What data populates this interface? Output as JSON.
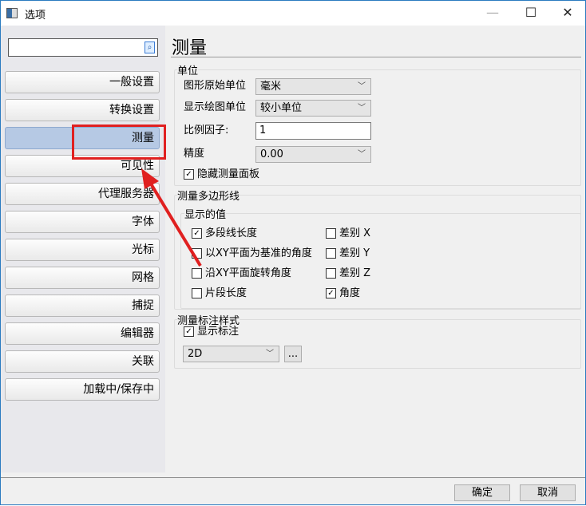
{
  "window": {
    "title": "选项",
    "minimize": "—",
    "maximize": "☐",
    "close": "✕"
  },
  "sidebar": {
    "search_value": "",
    "items": [
      {
        "label": "一般设置"
      },
      {
        "label": "转换设置"
      },
      {
        "label": "测量",
        "selected": true
      },
      {
        "label": "可见性"
      },
      {
        "label": "代理服务器"
      },
      {
        "label": "字体"
      },
      {
        "label": "光标"
      },
      {
        "label": "网格"
      },
      {
        "label": "捕捉"
      },
      {
        "label": "编辑器"
      },
      {
        "label": "关联"
      },
      {
        "label": "加载中/保存中"
      }
    ]
  },
  "main": {
    "title": "测量",
    "units": {
      "label": "单位",
      "orig_unit_label": "图形原始单位",
      "orig_unit_value": "毫米",
      "display_unit_label": "显示绘图单位",
      "display_unit_value": "较小单位",
      "scale_label": "比例因子:",
      "scale_value": "1",
      "precision_label": "精度",
      "precision_value": "0.00",
      "hide_panel_label": "隐藏测量面板",
      "hide_panel_checked": true
    },
    "polyline": {
      "label": "测量多边形线",
      "show_label": "显示的值",
      "options": [
        {
          "label": "多段线长度",
          "checked": true
        },
        {
          "label": "以XY平面为基准的角度",
          "checked": false
        },
        {
          "label": "沿XY平面旋转角度",
          "checked": false
        },
        {
          "label": "片段长度",
          "checked": false
        },
        {
          "label": "差别 X",
          "checked": false
        },
        {
          "label": "差别 Y",
          "checked": false
        },
        {
          "label": "差别 Z",
          "checked": false
        },
        {
          "label": "角度",
          "checked": true
        }
      ]
    },
    "annot": {
      "label": "测量标注样式",
      "show_label": "显示标注",
      "show_checked": true,
      "style_value": "2D",
      "more_label": "..."
    }
  },
  "footer": {
    "ok": "确定",
    "cancel": "取消"
  },
  "colors": {
    "highlight": "#e02020",
    "selected": "#b6c9e4"
  }
}
